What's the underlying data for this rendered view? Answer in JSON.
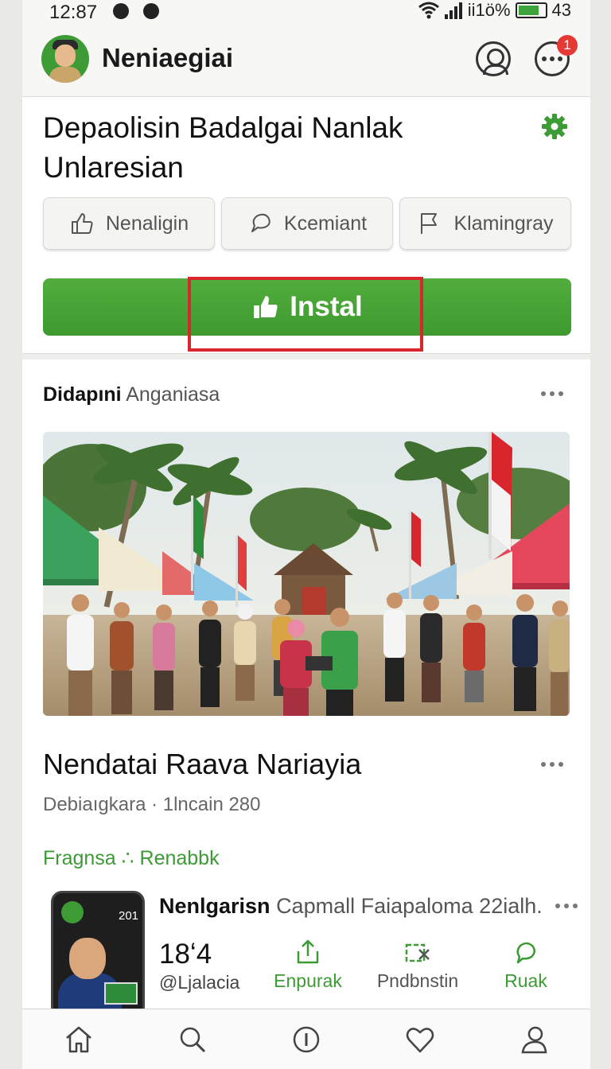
{
  "status_bar": {
    "time": "12:87",
    "battery": "ii1ö%",
    "signal_extra": "43"
  },
  "header": {
    "app_name": "Neniaegiai",
    "notification_count": "1"
  },
  "post": {
    "title": "Depaolisin Badalgai Nanlak Unlaresian",
    "actions": [
      "Nenaligin",
      "Kcemiant",
      "Klamingray"
    ],
    "install_label": "Instal"
  },
  "feed": {
    "section_name": "Didapıni",
    "section_sub": "Anganiasa",
    "story_title": "Nendatai Raava Nariayia",
    "story_meta": "Debiaıgkara · 1lncain 280",
    "story_link": "Fragnsa ∴ Renabbk",
    "sub_post": {
      "thumb_year": "201",
      "author": "Nenlgarisn",
      "caption": "Capmall Faiapaloma 22ialh.",
      "count": "18ʻ4",
      "handle": "@Ljalacia",
      "actions": [
        "Enpurak",
        "Pndbnstin",
        "Ruak"
      ]
    }
  },
  "colors": {
    "accent": "#3d9b35",
    "highlight_box": "#d8262c",
    "badge": "#e53935"
  }
}
